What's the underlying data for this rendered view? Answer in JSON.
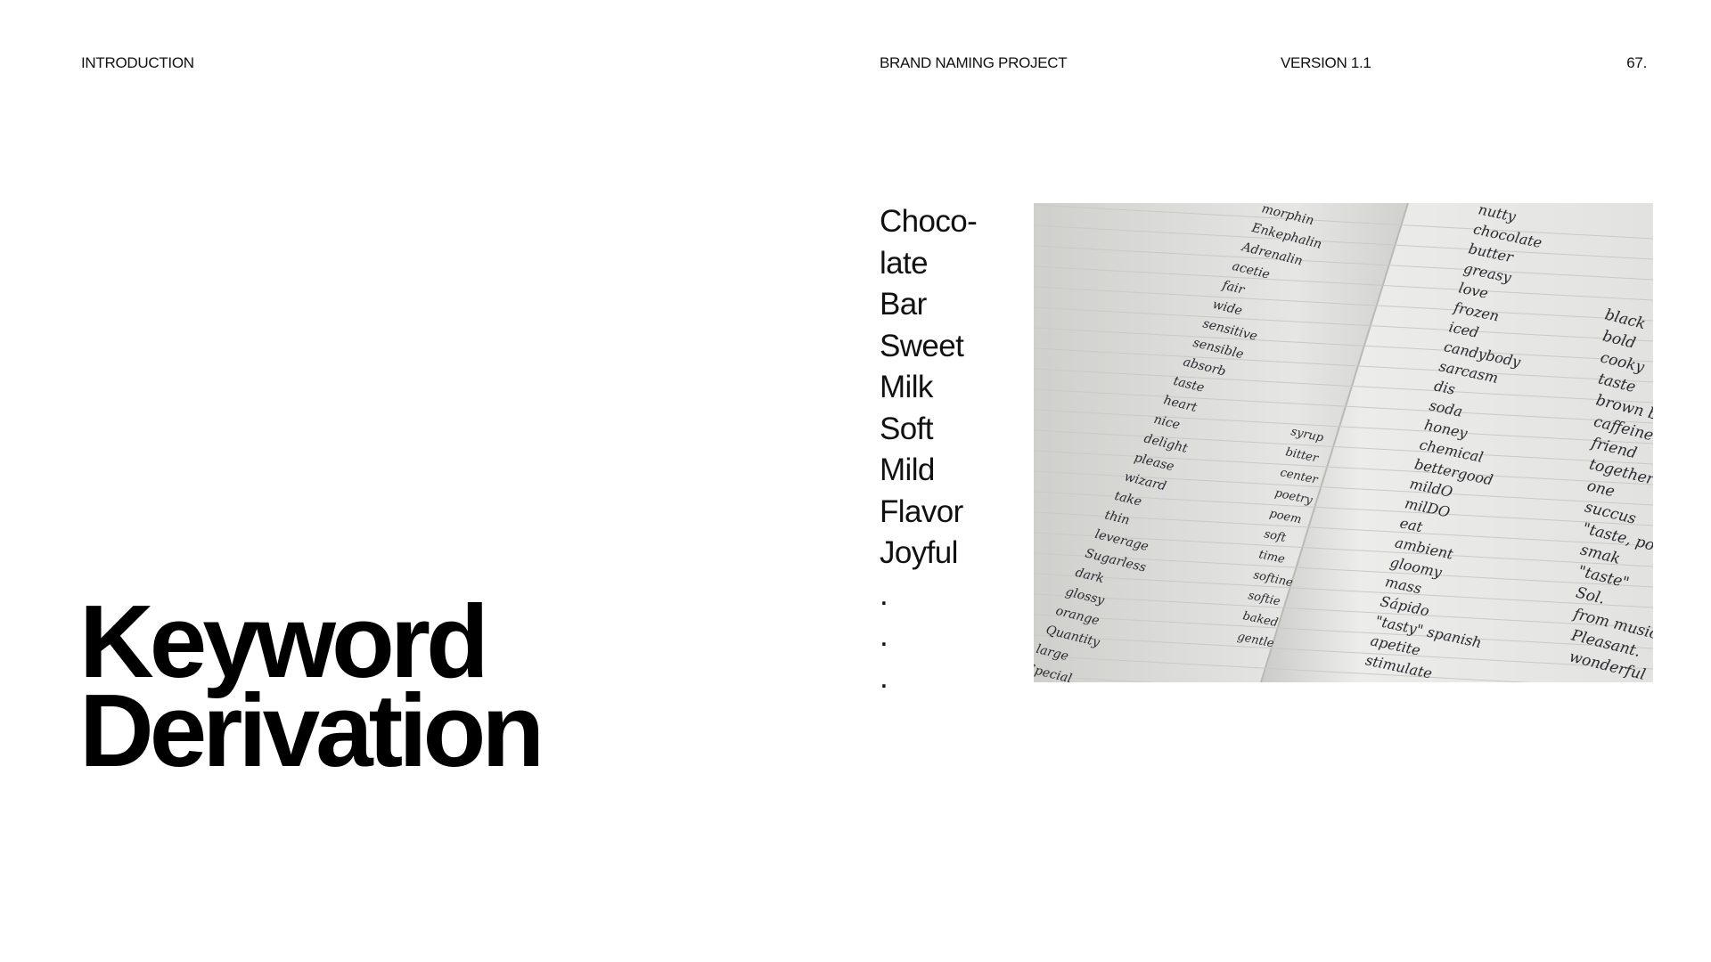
{
  "header": {
    "section": "INTRODUCTION",
    "project": "BRAND NAMING PROJECT",
    "version": "VERSION 1.1",
    "page_number": "67."
  },
  "keywords": [
    "Choco-",
    "late",
    "Bar",
    "Sweet",
    "Milk",
    "Soft",
    "Mild",
    "Flavor",
    "Joyful",
    ".",
    ".",
    "."
  ],
  "title": {
    "line1": "Keyword",
    "line2": "Derivation"
  },
  "photo": {
    "left_page_words": [
      "Special",
      "large",
      "Quantity",
      "orange",
      "glossy",
      "dark",
      "Sugarless",
      "leverage",
      "thin",
      "take",
      "wizard",
      "please",
      "delight",
      "nice",
      "heart",
      "taste",
      "absorb",
      "sensible",
      "sensitive",
      "wide",
      "fair",
      "acetie",
      "Adrenalin",
      "Enkephalin",
      "morphin"
    ],
    "right_page_words": [
      "nutty",
      "chocolate",
      "butter",
      "greasy",
      "love",
      "frozen",
      "iced",
      "candybody",
      "sarcasm",
      "dis",
      "soda",
      "honey",
      "chemical",
      "bettergood",
      "mildO",
      "milDO",
      "eat",
      "ambient",
      "gloomy",
      "mass",
      "Sápido",
      "\"tasty\" spanish",
      "apetite",
      "stimulate",
      "syrup",
      "bitter",
      "center",
      "poetry",
      "poem",
      "soft",
      "time",
      "softine",
      "softie",
      "baked",
      "gentle"
    ],
    "far_right_words": [
      "black",
      "bold",
      "cooky",
      "taste",
      "brown black",
      "caffeine",
      "friend",
      "together",
      "one",
      "succus",
      "\"taste, power\"",
      "smak",
      "\"taste\"",
      "Sol.",
      "from musical",
      "Pleasant.",
      "wonderful"
    ]
  }
}
